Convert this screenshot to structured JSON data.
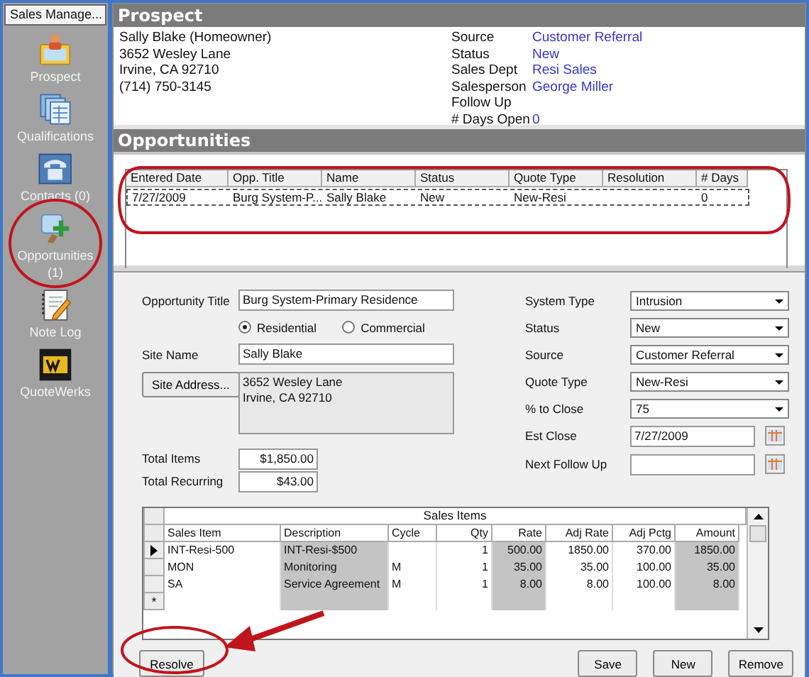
{
  "sidebar": {
    "title": "Sales Manage...",
    "items": [
      {
        "label": "Prospect",
        "kind": "prospect"
      },
      {
        "label": "Qualifications",
        "kind": "qualifications"
      },
      {
        "label": "Contacts (0)",
        "kind": "contacts"
      },
      {
        "label": "Opportunities\n(1)",
        "kind": "opportunities"
      },
      {
        "label": "Note Log",
        "kind": "notelog"
      },
      {
        "label": "QuoteWerks",
        "kind": "quotewerks"
      }
    ]
  },
  "prospect": {
    "title": "Prospect",
    "lines": [
      "Sally Blake  (Homeowner)",
      "3652 Wesley Lane",
      "Irvine, CA 92710",
      "(714) 750-3145"
    ],
    "fields": [
      {
        "label": "Source",
        "value": "Customer Referral"
      },
      {
        "label": "Status",
        "value": "New"
      },
      {
        "label": "Sales Dept",
        "value": "Resi Sales"
      },
      {
        "label": "Salesperson",
        "value": "George Miller"
      },
      {
        "label": "Follow Up"
      },
      {
        "label": "# Days Open",
        "value": "0"
      }
    ]
  },
  "opportunities": {
    "title": "Opportunities",
    "columns": [
      "Entered Date",
      "Opp. Title",
      "Name",
      "Status",
      "Quote Type",
      "Resolution",
      "# Days"
    ],
    "rows": [
      {
        "cells": [
          "7/27/2009",
          "Burg System-P...",
          "Sally Blake",
          "New",
          "New-Resi",
          "",
          "0"
        ],
        "selected": true
      }
    ]
  },
  "form": {
    "title": {
      "label": "Opportunity Title",
      "value": "Burg System-Primary Residence"
    },
    "radios": [
      {
        "label": "Residential",
        "selected": true
      },
      {
        "label": "Commercial",
        "selected": false
      }
    ],
    "site_name": {
      "label": "Site Name",
      "value": "Sally Blake"
    },
    "site_address": {
      "button": "Site Address...",
      "value": "3652 Wesley Lane\nIrvine, CA  92710"
    },
    "totals": [
      {
        "label": "Total Items",
        "value": "$1,850.00"
      },
      {
        "label": "Total Recurring",
        "value": "$43.00"
      }
    ],
    "right_fields": [
      {
        "label": "System Type",
        "value": "Intrusion",
        "kind": "select"
      },
      {
        "label": "Status",
        "value": "New",
        "kind": "select"
      },
      {
        "label": "Source",
        "value": "Customer Referral",
        "kind": "select"
      },
      {
        "label": "Quote Type",
        "value": "New-Resi",
        "kind": "select"
      },
      {
        "label": "% to Close",
        "value": "75",
        "kind": "select"
      },
      {
        "label": "Est Close",
        "value": "7/27/2009",
        "kind": "date"
      },
      {
        "label": "Next Follow Up",
        "kind": "date"
      }
    ]
  },
  "sales_items": {
    "title": "Sales Items",
    "columns": [
      {
        "label": "Sales Item",
        "readonly": false
      },
      {
        "label": "Description",
        "readonly": true
      },
      {
        "label": "Cycle",
        "readonly": false
      },
      {
        "label": "Qty",
        "readonly": false
      },
      {
        "label": "Rate",
        "readonly": true
      },
      {
        "label": "Adj Rate",
        "readonly": false
      },
      {
        "label": "Adj Pctg",
        "readonly": false
      },
      {
        "label": "Amount",
        "readonly": true
      }
    ],
    "rows": [
      {
        "current": true,
        "cells": [
          "INT-Resi-500",
          "INT-Resi-$500",
          "",
          "1",
          "500.00",
          "1850.00",
          "370.00",
          "1850.00"
        ]
      },
      {
        "current": false,
        "cells": [
          "MON",
          "Monitoring",
          "M",
          "1",
          "35.00",
          "35.00",
          "100.00",
          "35.00"
        ]
      },
      {
        "current": false,
        "cells": [
          "SA",
          "Service Agreement",
          "M",
          "1",
          "8.00",
          "8.00",
          "100.00",
          "8.00"
        ]
      }
    ],
    "new_row_marker": "*"
  },
  "buttons": [
    "Resolve",
    "Save",
    "New",
    "Remove"
  ]
}
